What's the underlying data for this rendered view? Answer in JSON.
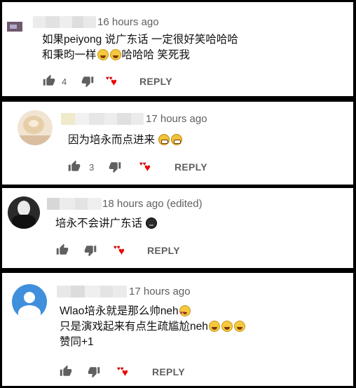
{
  "comments": [
    {
      "timestamp": "16 hours ago",
      "lines": [
        "如果peiyong 说广东话 一定很好笑哈哈哈",
        "和秉昀一样",
        "哈哈哈 笑死我"
      ],
      "emojis_line2": [
        "grinning-squinting-face",
        "grinning-squinting-face"
      ],
      "like_count": "4",
      "reply_label": "REPLY"
    },
    {
      "timestamp": "17 hours ago",
      "lines": [
        "因为培永而点进来"
      ],
      "emojis_line1": [
        "squinting-face",
        "squinting-face"
      ],
      "like_count": "3",
      "reply_label": "REPLY"
    },
    {
      "timestamp": "18 hours ago (edited)",
      "lines": [
        "培永不会讲广东话"
      ],
      "emojis_line1": [
        "dark-face"
      ],
      "like_count": "",
      "reply_label": "REPLY"
    },
    {
      "timestamp": "17 hours ago",
      "lines": [
        "Wlao培永就是那么帅neh",
        "只是演戏起来有点生疏尴尬neh",
        "赞同+1"
      ],
      "emojis_line1": [
        "heart-eyes-face"
      ],
      "emojis_line2": [
        "grinning-squinting-face",
        "grinning-squinting-face",
        "grinning-squinting-face"
      ],
      "like_count": "",
      "reply_label": "REPLY"
    }
  ],
  "icons": {
    "like": "thumbs-up-icon",
    "dislike": "thumbs-down-icon",
    "creator_heart": "creator-heart-icon"
  }
}
